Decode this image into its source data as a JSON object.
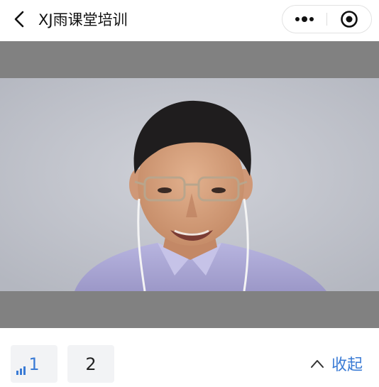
{
  "header": {
    "title": "XJ雨课堂培训",
    "back_icon": "chevron-left-icon",
    "more_icon": "more-dots-icon",
    "close_icon": "target-close-icon"
  },
  "video": {
    "content": "live-lecture-video"
  },
  "footer": {
    "lines": [
      {
        "label": "1",
        "selected": true,
        "icon": "signal-bars-icon"
      },
      {
        "label": "2",
        "selected": false
      }
    ],
    "collapse_label": "收起",
    "collapse_icon": "chevron-up-icon"
  },
  "colors": {
    "accent": "#3a7bd5",
    "video_backdrop": "#818181",
    "chip_bg": "#f2f3f5"
  }
}
